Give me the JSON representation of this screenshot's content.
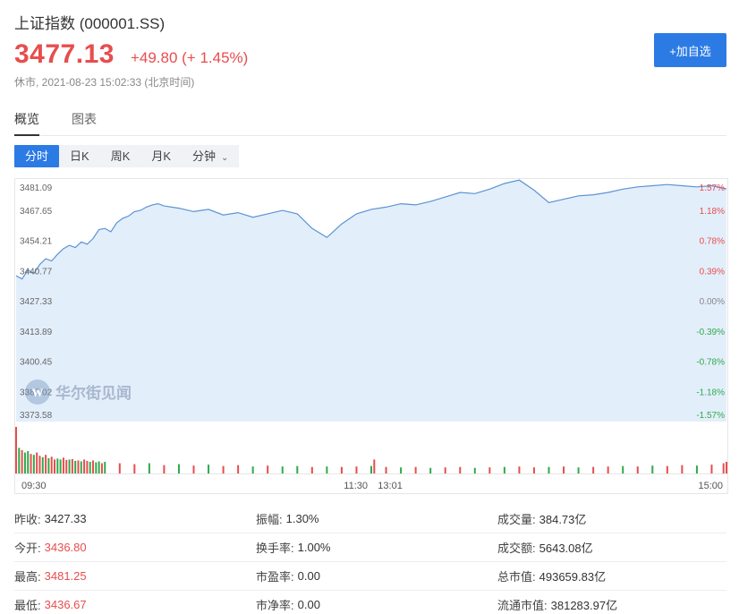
{
  "header": {
    "title": "上证指数 (000001.SS)",
    "price": "3477.13",
    "change": "+49.80 (+ 1.45%)",
    "status": "休市, 2021-08-23 15:02:33 (北京时间)",
    "add_label": "+加自选"
  },
  "tabs": [
    {
      "label": "概览",
      "active": true
    },
    {
      "label": "图表",
      "active": false
    }
  ],
  "periods": [
    {
      "label": "分时",
      "active": true
    },
    {
      "label": "日K",
      "active": false
    },
    {
      "label": "周K",
      "active": false
    },
    {
      "label": "月K",
      "active": false
    },
    {
      "label": "分钟",
      "active": false,
      "dropdown": true
    }
  ],
  "watermark": "华尔街见闻",
  "colors": {
    "up": "#e84d4d",
    "down": "#2eaa4a",
    "line": "#5b93d3",
    "area": "#e3eefb",
    "accent": "#2c7be5"
  },
  "chart_data": {
    "type": "area",
    "prev_close": 3427.33,
    "ylim": [
      3373.58,
      3481.09
    ],
    "y_ticks_left": [
      "3481.09",
      "3467.65",
      "3454.21",
      "3440.77",
      "3427.33",
      "3413.89",
      "3400.45",
      "3387.02",
      "3373.58"
    ],
    "y_ticks_right": [
      "1.57%",
      "1.18%",
      "0.78%",
      "0.39%",
      "0.00%",
      "-0.39%",
      "-0.78%",
      "-1.18%",
      "-1.57%"
    ],
    "x_ticks": [
      "09:30",
      "11:30",
      "13:01",
      "15:00"
    ],
    "price_series": {
      "name": "",
      "x_minutes": [
        0,
        2,
        4,
        6,
        8,
        10,
        12,
        14,
        16,
        18,
        20,
        22,
        24,
        26,
        28,
        30,
        32,
        34,
        36,
        38,
        40,
        42,
        44,
        46,
        48,
        50,
        55,
        60,
        65,
        70,
        75,
        80,
        85,
        90,
        95,
        100,
        105,
        110,
        115,
        120,
        125,
        130,
        135,
        140,
        145,
        150,
        155,
        160,
        165,
        170,
        175,
        180,
        185,
        190,
        195,
        200,
        205,
        210,
        215,
        220,
        225,
        230,
        235,
        240
      ],
      "values": [
        3438.5,
        3437.0,
        3441.0,
        3439.5,
        3443.5,
        3446.0,
        3445.0,
        3448.0,
        3450.5,
        3452.0,
        3451.0,
        3453.5,
        3452.5,
        3455.0,
        3459.0,
        3459.5,
        3458.0,
        3462.0,
        3464.0,
        3465.0,
        3467.0,
        3467.5,
        3469.0,
        3470.0,
        3470.5,
        3469.5,
        3468.5,
        3467.0,
        3468.0,
        3465.5,
        3466.5,
        3464.5,
        3466.0,
        3467.5,
        3466.0,
        3459.5,
        3455.5,
        3461.5,
        3466.0,
        3468.0,
        3469.0,
        3470.5,
        3470.0,
        3471.5,
        3473.5,
        3475.5,
        3475.0,
        3477.0,
        3479.5,
        3481.0,
        3476.5,
        3471.0,
        3472.5,
        3474.0,
        3474.5,
        3475.5,
        3477.0,
        3478.0,
        3478.5,
        3479.0,
        3478.5,
        3478.0,
        3478.5,
        3477.1
      ]
    },
    "volume_series": {
      "name": "",
      "x_minutes": [
        0,
        1,
        2,
        3,
        4,
        5,
        6,
        7,
        8,
        9,
        10,
        11,
        12,
        13,
        14,
        15,
        16,
        17,
        18,
        19,
        20,
        21,
        22,
        23,
        24,
        25,
        26,
        27,
        28,
        29,
        30,
        35,
        40,
        45,
        50,
        55,
        60,
        65,
        70,
        75,
        80,
        85,
        90,
        95,
        100,
        105,
        110,
        115,
        120,
        121,
        125,
        130,
        135,
        140,
        145,
        150,
        155,
        160,
        165,
        170,
        175,
        180,
        185,
        190,
        195,
        200,
        205,
        210,
        215,
        220,
        225,
        230,
        235,
        239,
        240
      ],
      "values": [
        1.0,
        0.55,
        0.5,
        0.45,
        0.48,
        0.42,
        0.4,
        0.45,
        0.38,
        0.35,
        0.4,
        0.33,
        0.36,
        0.3,
        0.32,
        0.3,
        0.34,
        0.29,
        0.3,
        0.31,
        0.27,
        0.28,
        0.26,
        0.3,
        0.27,
        0.25,
        0.28,
        0.24,
        0.26,
        0.22,
        0.25,
        0.22,
        0.2,
        0.22,
        0.18,
        0.2,
        0.17,
        0.19,
        0.16,
        0.18,
        0.15,
        0.17,
        0.15,
        0.16,
        0.14,
        0.15,
        0.14,
        0.15,
        0.16,
        0.3,
        0.14,
        0.13,
        0.14,
        0.12,
        0.13,
        0.14,
        0.12,
        0.13,
        0.14,
        0.15,
        0.13,
        0.14,
        0.15,
        0.13,
        0.14,
        0.15,
        0.16,
        0.15,
        0.17,
        0.16,
        0.18,
        0.17,
        0.19,
        0.22,
        0.25
      ],
      "up_flags": [
        1,
        0,
        1,
        0,
        0,
        1,
        0,
        1,
        1,
        0,
        1,
        0,
        1,
        1,
        0,
        0,
        1,
        1,
        0,
        1,
        0,
        1,
        0,
        1,
        1,
        0,
        1,
        0,
        0,
        1,
        0,
        1,
        1,
        0,
        1,
        0,
        1,
        0,
        1,
        1,
        0,
        1,
        0,
        0,
        1,
        0,
        1,
        1,
        0,
        1,
        1,
        0,
        1,
        0,
        1,
        1,
        0,
        1,
        0,
        1,
        1,
        0,
        1,
        0,
        1,
        1,
        0,
        1,
        0,
        1,
        1,
        0,
        1,
        1,
        1
      ]
    }
  },
  "stats": [
    [
      {
        "label": "昨收:",
        "value": "3427.33",
        "color": "plain"
      },
      {
        "label": "振幅:",
        "value": "1.30%",
        "color": "plain"
      },
      {
        "label": "成交量:",
        "value": "384.73亿",
        "color": "plain"
      }
    ],
    [
      {
        "label": "今开:",
        "value": "3436.80",
        "color": "up"
      },
      {
        "label": "换手率:",
        "value": "1.00%",
        "color": "plain"
      },
      {
        "label": "成交额:",
        "value": "5643.08亿",
        "color": "plain"
      }
    ],
    [
      {
        "label": "最高:",
        "value": "3481.25",
        "color": "up"
      },
      {
        "label": "市盈率:",
        "value": "0.00",
        "color": "plain"
      },
      {
        "label": "总市值:",
        "value": "493659.83亿",
        "color": "plain"
      }
    ],
    [
      {
        "label": "最低:",
        "value": "3436.67",
        "color": "up"
      },
      {
        "label": "市净率:",
        "value": "0.00",
        "color": "plain"
      },
      {
        "label": "流通市值:",
        "value": "381283.97亿",
        "color": "plain"
      }
    ]
  ]
}
